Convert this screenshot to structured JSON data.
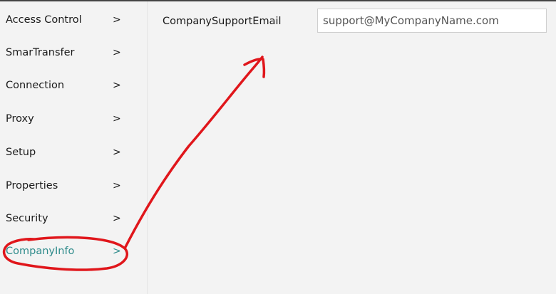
{
  "sidebar": {
    "items": [
      {
        "label": "Access Control",
        "chevron": ">"
      },
      {
        "label": "SmarTransfer",
        "chevron": ">"
      },
      {
        "label": "Connection",
        "chevron": ">"
      },
      {
        "label": "Proxy",
        "chevron": ">"
      },
      {
        "label": "Setup",
        "chevron": ">"
      },
      {
        "label": "Properties",
        "chevron": ">"
      },
      {
        "label": "Security",
        "chevron": ">"
      },
      {
        "label": "CompanyInfo",
        "chevron": ">"
      }
    ],
    "active_color": "#2e8b8b"
  },
  "main": {
    "field": {
      "label": "CompanySupportEmail",
      "placeholder": "support@MyCompanyName.com",
      "value": ""
    }
  },
  "annotation": {
    "color": "#e0161b"
  }
}
